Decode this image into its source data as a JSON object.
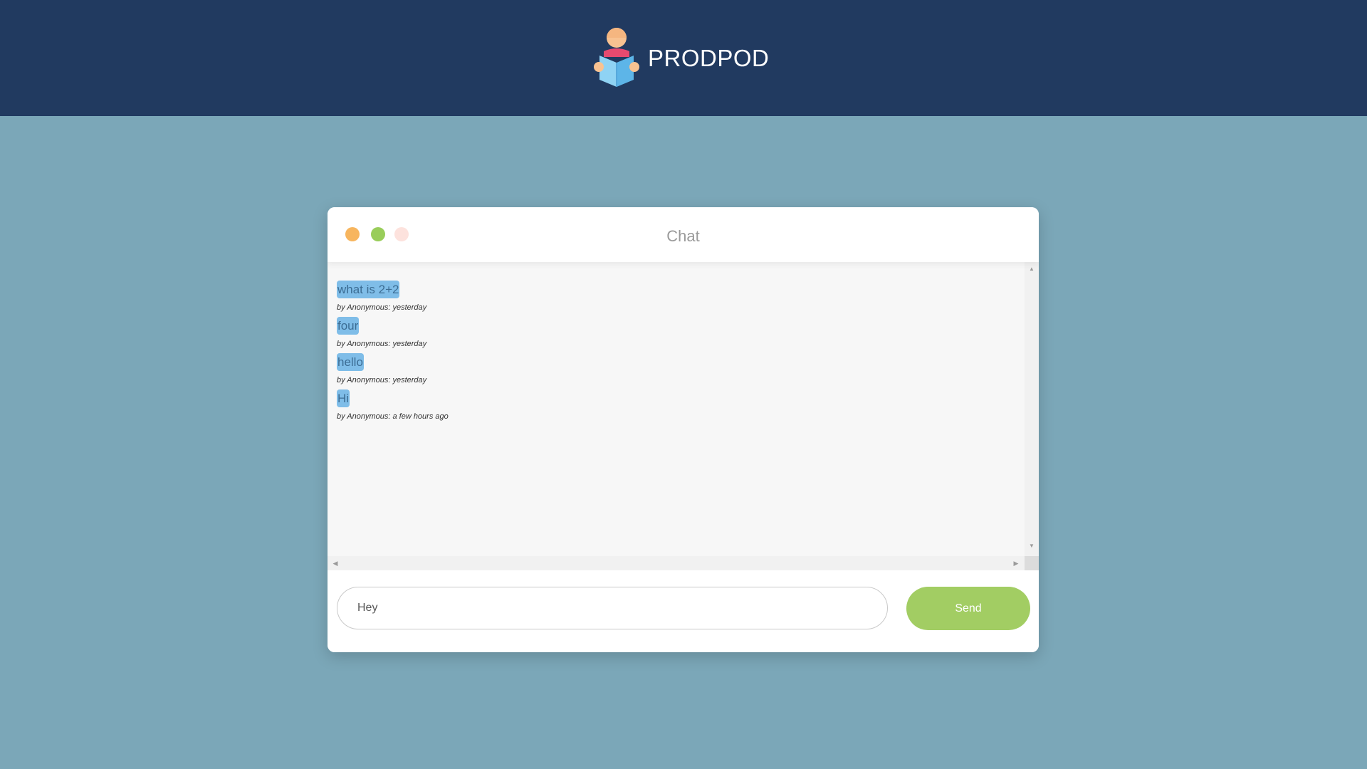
{
  "header": {
    "brand_name": "PRODPOD",
    "logo_icon": "reader-icon"
  },
  "chat": {
    "title": "Chat",
    "window_controls": [
      {
        "name": "close",
        "color": "#f7b55e"
      },
      {
        "name": "minimize",
        "color": "#99cd5a"
      },
      {
        "name": "maximize",
        "color": "#fde2dd"
      }
    ],
    "messages": [
      {
        "text": "what is 2+2",
        "meta": "by Anonymous: yesterday"
      },
      {
        "text": "four",
        "meta": "by Anonymous: yesterday"
      },
      {
        "text": "hello",
        "meta": "by Anonymous: yesterday"
      },
      {
        "text": "Hi",
        "meta": "by Anonymous: a few hours ago"
      }
    ],
    "input": {
      "value": "Hey",
      "placeholder": ""
    },
    "send_label": "Send"
  },
  "colors": {
    "header_bg": "#213a60",
    "page_bg": "#7ba7b8",
    "bubble_bg": "#7fbde8",
    "send_bg": "#a2cd63"
  }
}
